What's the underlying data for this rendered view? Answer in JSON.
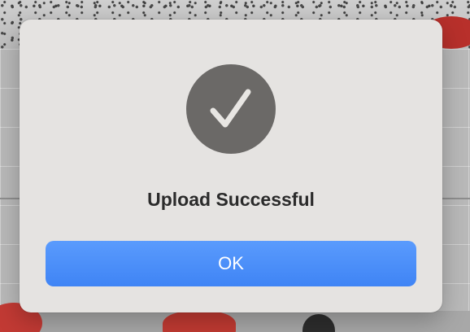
{
  "dialog": {
    "icon": "checkmark-circle-icon",
    "title": "Upload Successful",
    "ok_label": "OK"
  },
  "colors": {
    "dialog_background": "#e5e3e1",
    "icon_background": "#6b6967",
    "button_accent": "#4a8ff9",
    "button_text": "#ffffff",
    "title_text": "#2b2b2b"
  }
}
